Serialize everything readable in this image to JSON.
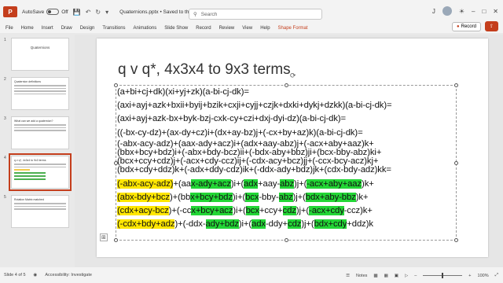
{
  "titlebar": {
    "logo": "P",
    "autosave_label": "AutoSave",
    "autosave_state": "Off",
    "document_name": "Quaternions.pptx • Saved to this PC ⌄",
    "search_placeholder": "Search",
    "user_initials": "J"
  },
  "ribbon": {
    "tabs": [
      "File",
      "Home",
      "Insert",
      "Draw",
      "Design",
      "Transitions",
      "Animations",
      "Slide Show",
      "Record",
      "Review",
      "View",
      "Help",
      "Shape Format"
    ],
    "record_button": "Record",
    "share_button": "⇪"
  },
  "thumbnails": [
    {
      "number": "1",
      "title": "Quaternions"
    },
    {
      "number": "2",
      "title": "Quaternion definitions"
    },
    {
      "number": "3",
      "title": "What can we add a quaternion?"
    },
    {
      "number": "4",
      "title": "q v q*, 4x3x4 to 9x3 terms"
    },
    {
      "number": "5",
      "title": "Rotation Matrix matched"
    }
  ],
  "slide": {
    "title": "q v q*, 4x3x4 to 9x3 terms",
    "lines": [
      "(a+bi+cj+dk)(xi+yj+zk)(a-bi-cj-dk)=",
      "(axi+ayj+azk+bxii+byij+bzik+cxji+cyjj+czjk+dxki+dykj+dzkk)(a-bi-cj-dk)=",
      "(axi+ayj+azk-bx+byk-bzj-cxk-cy+czi+dxj-dyi-dz)(a-bi-cj-dk)=",
      "((-bx-cy-dz)+(ax-dy+cz)i+(dx+ay-bz)j+(-cx+by+az)k)(a-bi-cj-dk)=",
      "(-abx-acy-adz)+(aax-ady+acz)i+(adx+aay-abz)j+(-acx+aby+aaz)k+",
      "(bbx+bcy+bdz)i+(-abx+bdy-bcz)ii+(-bdx-aby+bbz)ji+(bcx-bby-abz)ki+",
      "(bcx+ccy+cdz)j+(-acx+cdy-ccz)ij+(-cdx-acy+bcz)jj+(-ccx-bcy-acz)kj+",
      "(bdx+cdy+ddz)k+(-adx+ddy-cdz)ik+(-ddx-ady+bdz)jk+(cdx-bdy-adz)kk="
    ],
    "highlighted_lines": [
      [
        {
          "t": "(-abx-acy-a",
          "h": "y"
        },
        {
          "t": "d",
          "h": "y"
        },
        {
          "t": "z)",
          "h": "y"
        },
        {
          "t": "+(aa",
          "h": ""
        },
        {
          "t": "x-ady+acz",
          "h": "g"
        },
        {
          "t": ")i+(",
          "h": ""
        },
        {
          "t": "adx",
          "h": "g"
        },
        {
          "t": "+aay-",
          "h": ""
        },
        {
          "t": "abz",
          "h": "g"
        },
        {
          "t": ")j+(",
          "h": ""
        },
        {
          "t": "-acx+aby+aaz",
          "h": "g"
        },
        {
          "t": ")k+",
          "h": ""
        }
      ],
      [
        {
          "t": "(abx-bdy+bcz",
          "h": "y"
        },
        {
          "t": ")+(bb",
          "h": ""
        },
        {
          "t": "x+bcy+bdz",
          "h": "g"
        },
        {
          "t": ")i+(",
          "h": ""
        },
        {
          "t": "bcx",
          "h": "g"
        },
        {
          "t": "-bby-",
          "h": ""
        },
        {
          "t": "abz",
          "h": "g"
        },
        {
          "t": ")j+(",
          "h": ""
        },
        {
          "t": "bdx+aby-bbz",
          "h": "g"
        },
        {
          "t": ")k+",
          "h": ""
        }
      ],
      [
        {
          "t": "(cdx+acy-bcz",
          "h": "y"
        },
        {
          "t": ")+(-cc",
          "h": ""
        },
        {
          "t": "x+bcy+acz",
          "h": "g"
        },
        {
          "t": ")i+(",
          "h": ""
        },
        {
          "t": "bcx",
          "h": "g"
        },
        {
          "t": "+ccy+",
          "h": ""
        },
        {
          "t": "cdz",
          "h": "g"
        },
        {
          "t": ")j+(",
          "h": ""
        },
        {
          "t": "-acx+cdy",
          "h": "g"
        },
        {
          "t": "-ccz)k+",
          "h": ""
        }
      ],
      [
        {
          "t": "(-cdx+bdy+adz",
          "h": "y"
        },
        {
          "t": ")+(-ddx-",
          "h": ""
        },
        {
          "t": "ady+bdz",
          "h": "g"
        },
        {
          "t": ")i+(",
          "h": ""
        },
        {
          "t": "adx",
          "h": "g"
        },
        {
          "t": "-ddy+",
          "h": ""
        },
        {
          "t": "cdz",
          "h": "g"
        },
        {
          "t": ")j+(",
          "h": ""
        },
        {
          "t": "bdx+cdy",
          "h": "g"
        },
        {
          "t": "+ddz)k",
          "h": ""
        }
      ]
    ]
  },
  "statusbar": {
    "slide_info": "Slide 4 of 5",
    "accessibility": "Accessibility: Investigate",
    "notes_label": "Notes",
    "zoom": "100%"
  }
}
